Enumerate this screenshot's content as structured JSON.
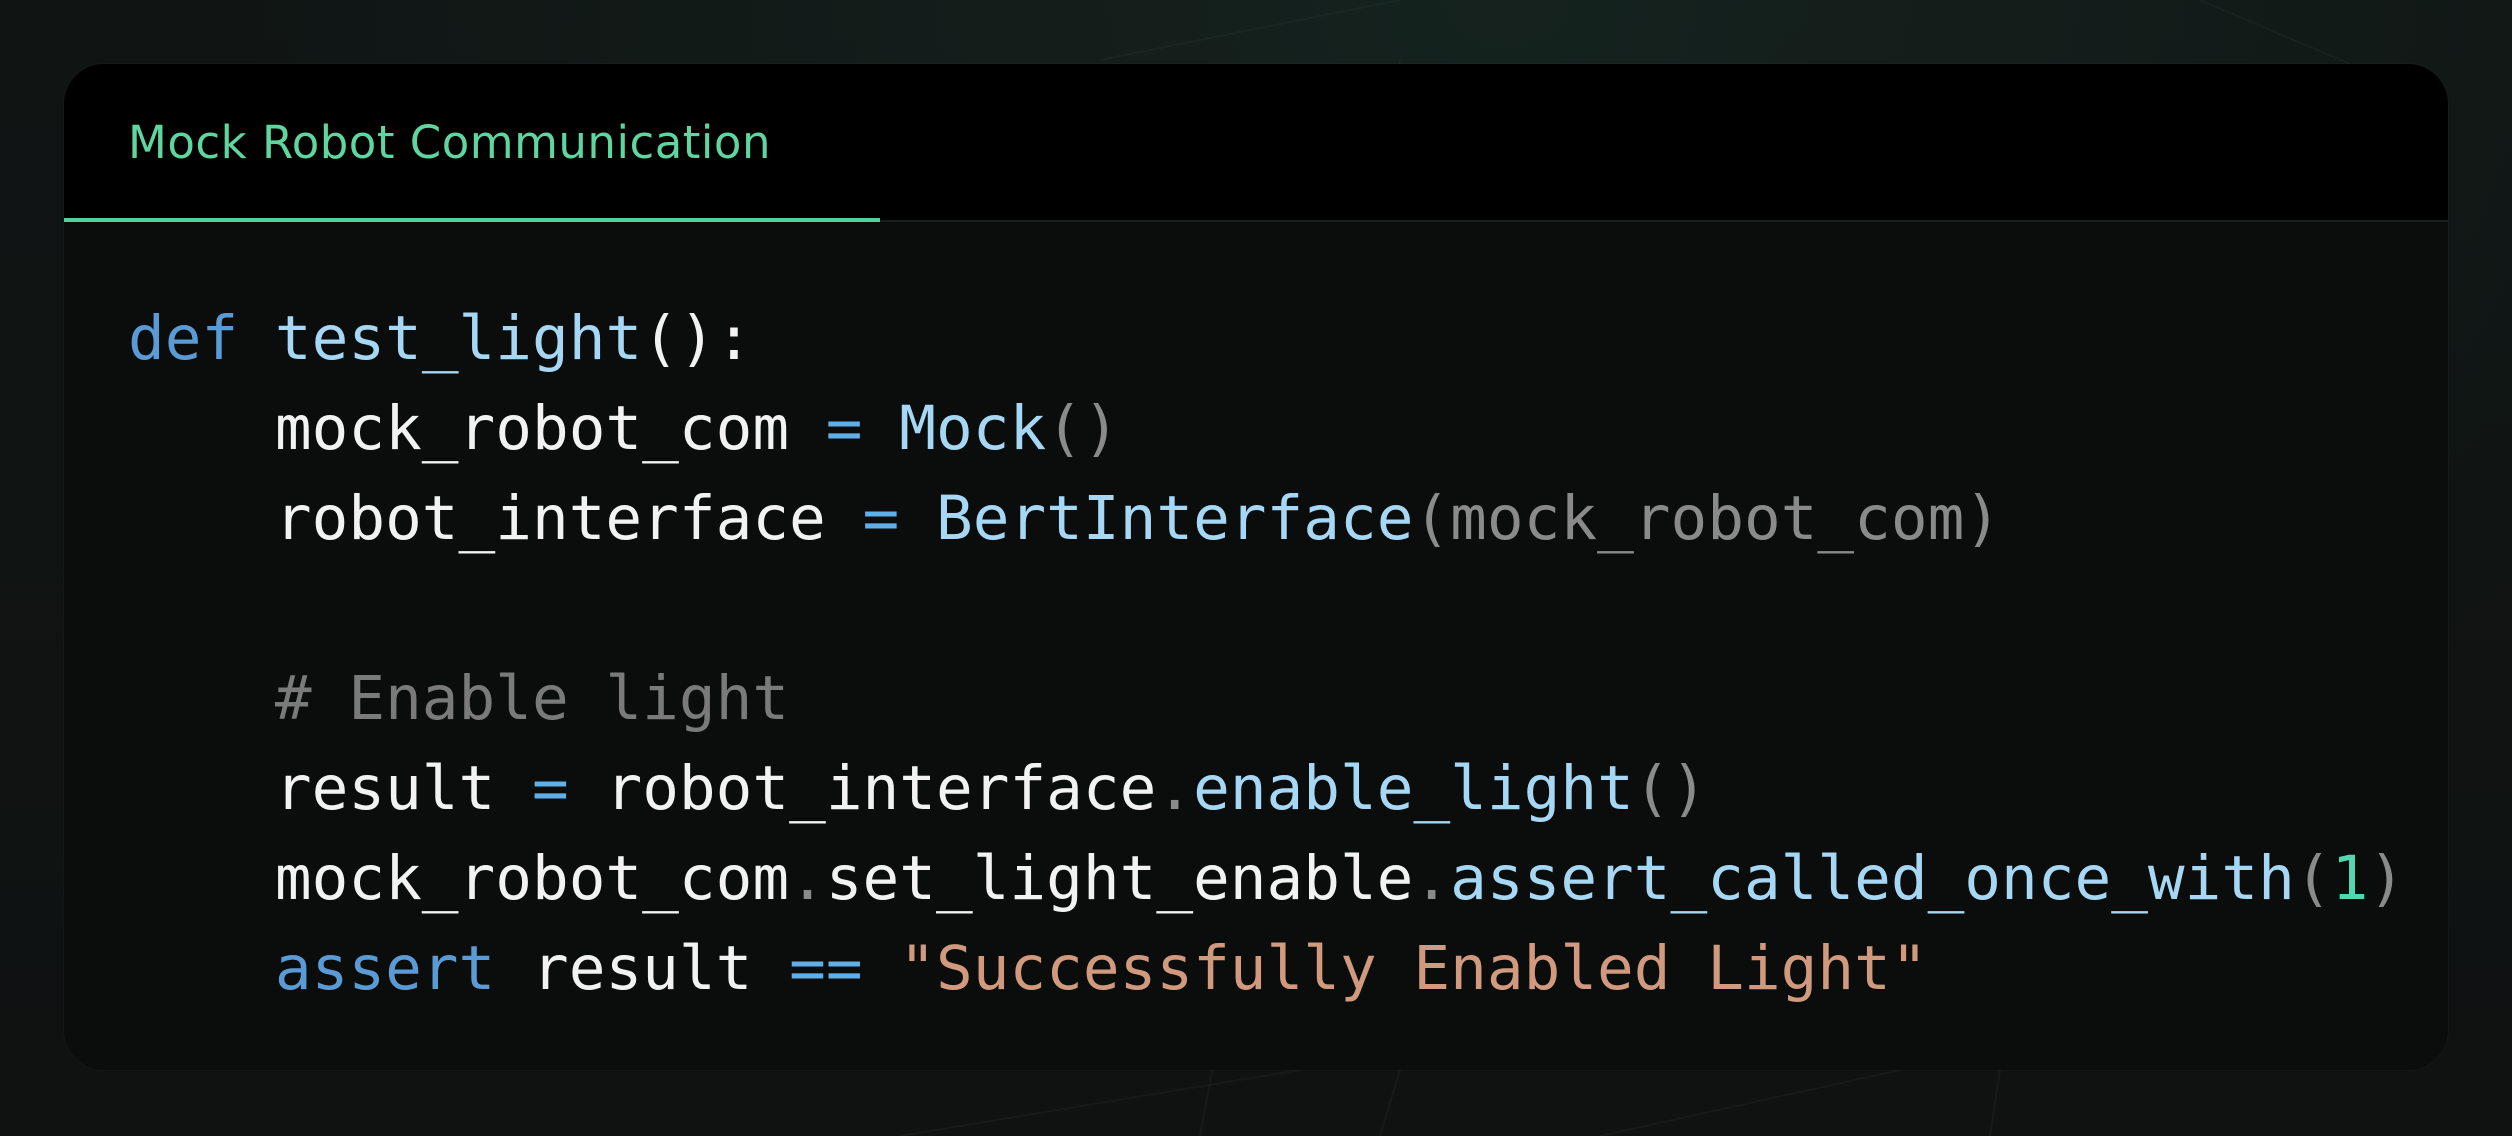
{
  "tab": {
    "label": "Mock Robot Communication"
  },
  "code": {
    "l1": {
      "kw": "def",
      "fn": "test_light",
      "punc": "():"
    },
    "l2": {
      "indent": "    ",
      "name": "mock_robot_com",
      "op": "=",
      "fn": "Mock",
      "punc": "()"
    },
    "l3": {
      "indent": "    ",
      "name": "robot_interface",
      "op": "=",
      "fn": "BertInterface",
      "open": "(",
      "arg": "mock_robot_com",
      "close": ")"
    },
    "l5": {
      "indent": "    ",
      "comment": "# Enable light"
    },
    "l6": {
      "indent": "    ",
      "name": "result",
      "op": "=",
      "obj": "robot_interface",
      "dot": ".",
      "method": "enable_light",
      "punc": "()"
    },
    "l7": {
      "indent": "    ",
      "obj": "mock_robot_com",
      "dot1": ".",
      "attr": "set_light_enable",
      "dot2": ".",
      "method": "assert_called_once_with",
      "open": "(",
      "num": "1",
      "close": ")"
    },
    "l8": {
      "indent": "    ",
      "kw": "assert",
      "name": "result",
      "op": "==",
      "str": "\"Successfully Enabled Light\""
    }
  },
  "colors": {
    "accent": "#4fd39a",
    "keyword": "#5b9bd5",
    "function": "#a6d8f5",
    "string": "#d19a7e",
    "number": "#55d6b0",
    "comment": "#7a7a7a"
  }
}
